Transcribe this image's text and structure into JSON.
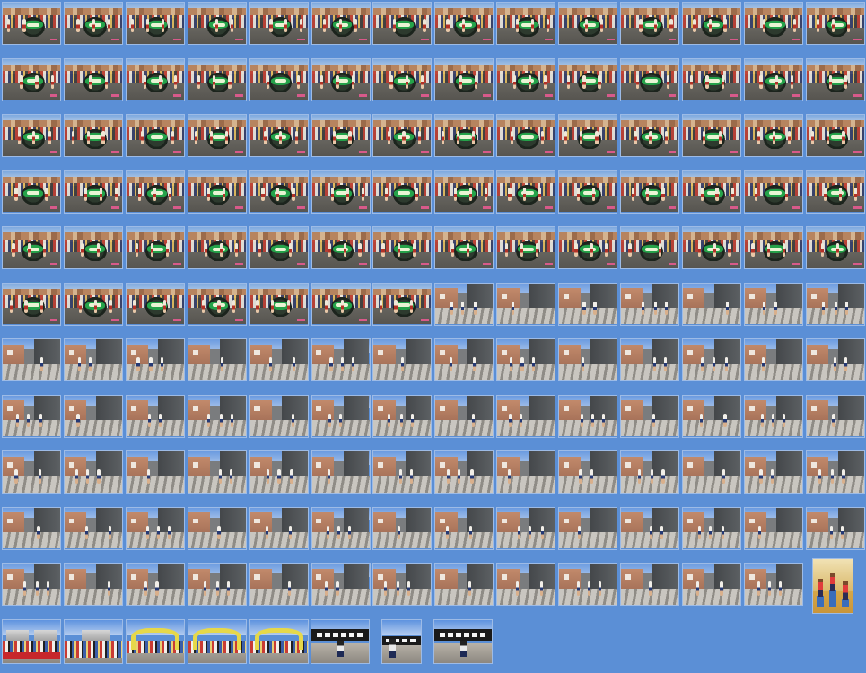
{
  "window": {
    "background": "#5b8fd6",
    "border_color": "#9dbbe6"
  },
  "gallery": {
    "rows": [
      {
        "row": 1,
        "scene": "car",
        "count": 14
      },
      {
        "row": 2,
        "scene": "car",
        "count": 14
      },
      {
        "row": 3,
        "scene": "car",
        "count": 14
      },
      {
        "row": 4,
        "scene": "car",
        "count": 14
      },
      {
        "row": 5,
        "scene": "car",
        "count": 14
      },
      {
        "row": 6,
        "scene": "mixed",
        "count": 14,
        "car_count": 7
      },
      {
        "row": 7,
        "scene": "street",
        "count": 14
      },
      {
        "row": 8,
        "scene": "street",
        "count": 14
      },
      {
        "row": 9,
        "scene": "street",
        "count": 14
      },
      {
        "row": 10,
        "scene": "street",
        "count": 14
      },
      {
        "row": 11,
        "scene": "street+podium",
        "count": 14,
        "street_count": 13
      },
      {
        "row": 12,
        "scene": "event",
        "count": 8
      }
    ],
    "last_row": [
      {
        "kind": "tents"
      },
      {
        "kind": "crowd"
      },
      {
        "kind": "arch"
      },
      {
        "kind": "arch"
      },
      {
        "kind": "arch"
      },
      {
        "kind": "sign"
      },
      {
        "kind": "portrait"
      },
      {
        "kind": "sign"
      }
    ]
  }
}
